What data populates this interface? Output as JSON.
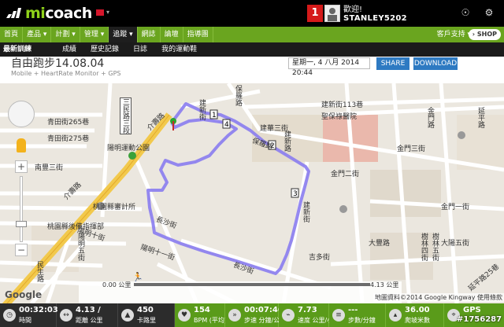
{
  "header": {
    "brand_mi": "mi",
    "brand_coach": "coach",
    "notification_count": "1",
    "welcome": "歡迎!",
    "username": "STANLEY5202"
  },
  "nav": {
    "items": [
      "首頁",
      "產品",
      "計劃",
      "管理",
      "追蹤",
      "網誌",
      "論壇",
      "指導團"
    ],
    "active_index": 4,
    "support": "客戶支持",
    "shop": "SHOP"
  },
  "subnav": {
    "items": [
      "最新訓練",
      "成績",
      "歷史記錄",
      "日誌",
      "我的運動鞋"
    ]
  },
  "activity": {
    "title": "自由跑步14.08.04",
    "subtitle": "Mobile + HeartRate Monitor + GPS",
    "date": "星期一, 4 八月 2014 20:44",
    "share_label": "SHARE",
    "download_label": "DOWNLOAD"
  },
  "map": {
    "labels": {
      "l1": "青田街265巷",
      "l2": "青田街275巷",
      "l3": "南豐三街",
      "l4": "介壽路",
      "l5": "三民路三段",
      "l6": "介壽路",
      "l7": "陽明運動公園",
      "l8": "桃園縣審計所",
      "l9": "桃園縣後備指揮部",
      "l10": "陽明十街",
      "l11": "陽明五街",
      "l12": "陽明十一街",
      "l13": "長沙街",
      "l14": "長沙街",
      "l15": "建新街",
      "l16": "建新街",
      "l17": "保羅路",
      "l18": "保羅路",
      "l19": "建華三街",
      "l20": "建新街113巷",
      "l21": "聖保祿醫院",
      "l22": "建新路",
      "l23": "金門二街",
      "l24": "金門三街",
      "l25": "金門一街",
      "l26": "金門路",
      "l27": "吉多街",
      "l28": "大豐路",
      "l29": "樹林四街",
      "l30": "樹林五街",
      "l31": "延平路",
      "l32": "延平路25巷",
      "l33": "大陽五街",
      "l34": "民生路"
    },
    "slider_start": "0.00 公里",
    "slider_end": "4.13 公里",
    "copyright": "地圖資料©2014 Google Kingway 使用條款",
    "google": "Google"
  },
  "stats": [
    {
      "value": "00:32:03",
      "label": "時間",
      "icon": "clock-icon"
    },
    {
      "value": "4.13",
      "unit": "/",
      "label": "距離 公里",
      "icon": "distance-icon"
    },
    {
      "value": "450",
      "label": "卡路里",
      "icon": "calories-icon"
    },
    {
      "value": "154",
      "label": "BPM (平均)",
      "icon": "heart-icon"
    },
    {
      "value": "00:07:46",
      "label": "步速 分鐘/公里",
      "icon": "pace-icon"
    },
    {
      "value": "7.73",
      "label": "速度 公里/小時",
      "icon": "speed-icon"
    },
    {
      "value": "---",
      "label": "步數/分鐘",
      "icon": "steps-icon"
    },
    {
      "value": "36.00",
      "label": "爬坡米數",
      "icon": "elevation-icon"
    },
    {
      "value": "GPS",
      "label": "",
      "icon": "gps-icon"
    }
  ],
  "watermark": "#1756287",
  "colors": {
    "brand_green": "#8fd21a",
    "nav_green": "#6aa51f",
    "route": "#8a7cf0",
    "button_blue": "#2e7ac2"
  }
}
